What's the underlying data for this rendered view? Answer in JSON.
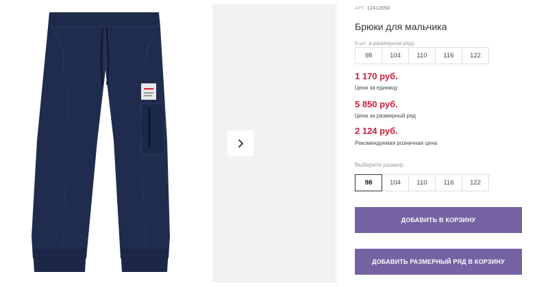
{
  "product": {
    "article_prefix": "АРТ.",
    "article_number": "12412050",
    "title": "Брюки для мальчика",
    "pack_label": "5 шт. в размерном ряду",
    "pack_sizes": [
      "98",
      "104",
      "110",
      "116",
      "122"
    ]
  },
  "prices": [
    {
      "value": "1 170 руб.",
      "note": "Цена за единицу"
    },
    {
      "value": "5 850 руб.",
      "note": "Цена за размерный ряд"
    },
    {
      "value": "2 124 руб.",
      "note": "Рекомендуемая розничная цена"
    }
  ],
  "size_select": {
    "label": "Выберите размер:",
    "options": [
      "98",
      "104",
      "110",
      "116",
      "122"
    ],
    "selected": "98"
  },
  "buttons": {
    "add_to_cart": "Добавить в корзину",
    "add_pack_to_cart": "Добавить размерный ряд в корзину"
  },
  "gallery": {
    "next_icon": "chevron-right-icon",
    "product_color": "#1f2c4d"
  },
  "colors": {
    "accent": "#7562a3",
    "price": "#cc1f3a"
  }
}
